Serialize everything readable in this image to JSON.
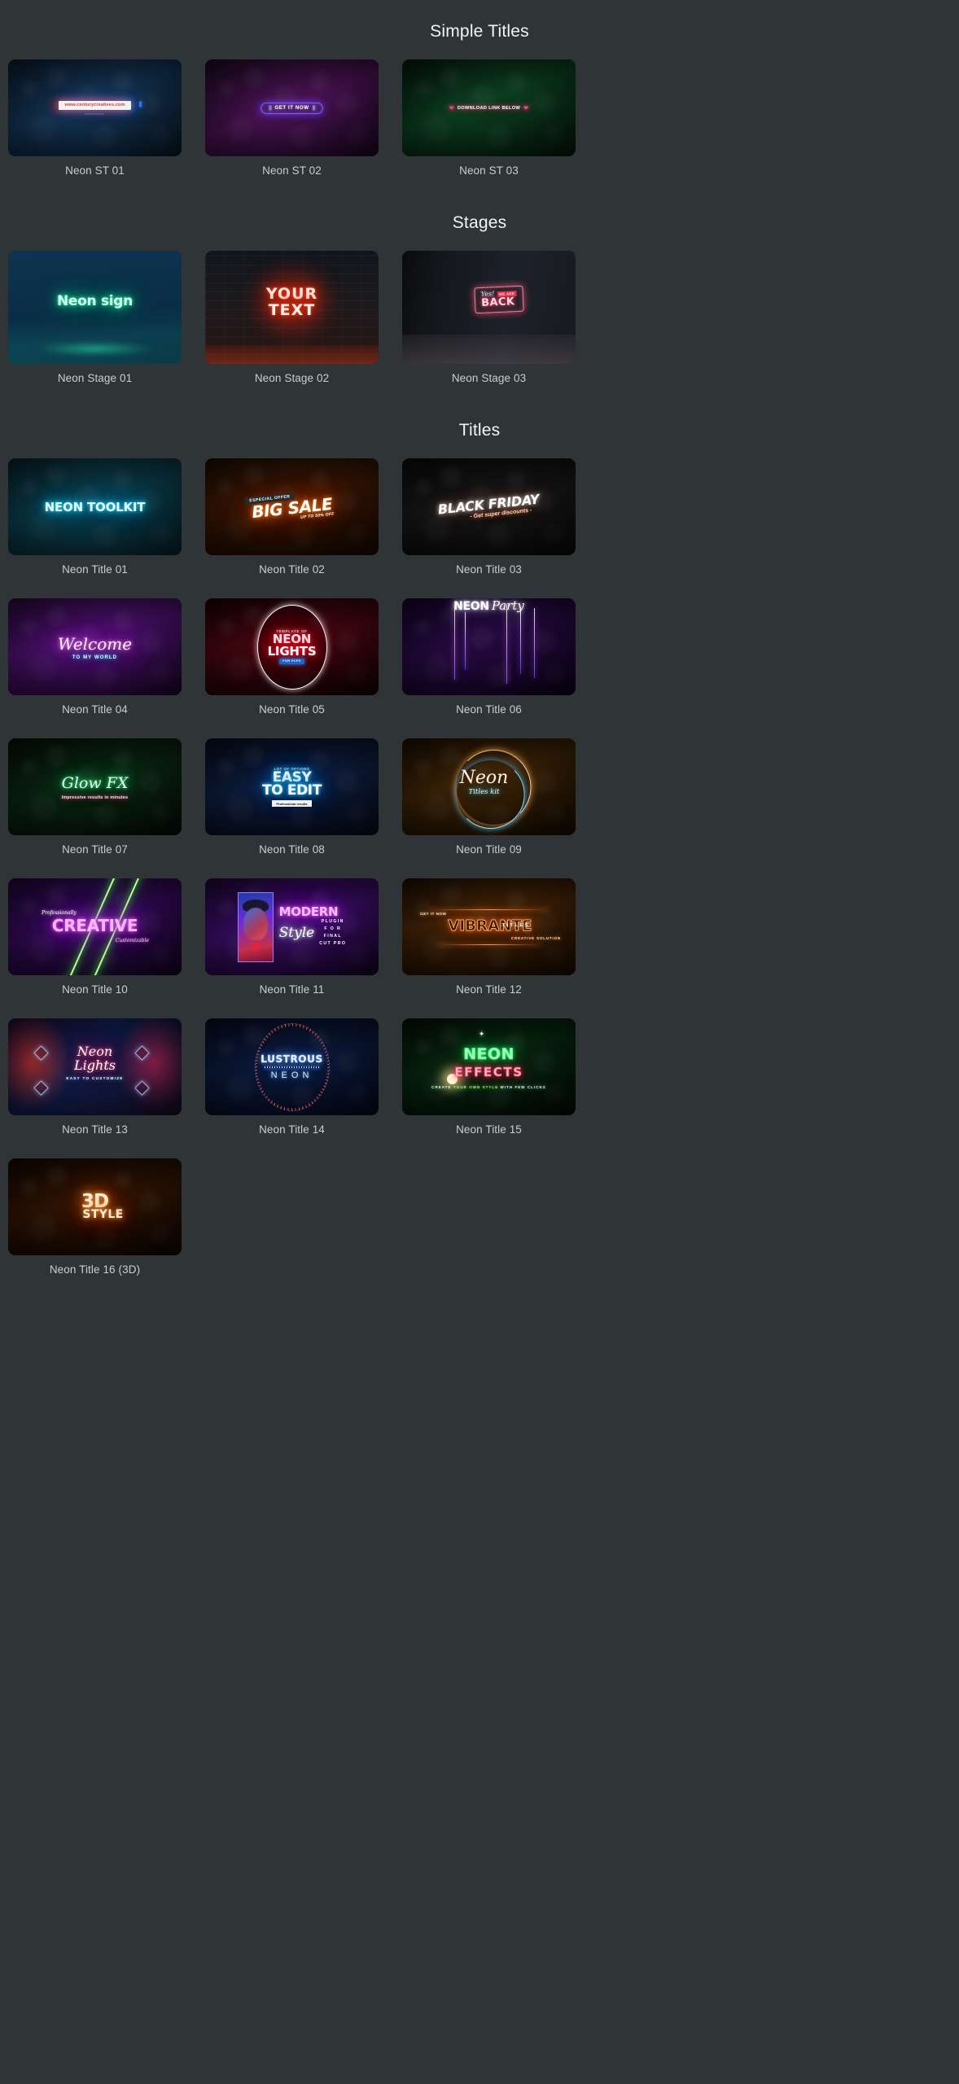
{
  "sections": [
    {
      "title": "Simple Titles",
      "items": [
        {
          "caption": "Neon ST 01",
          "art": {
            "url": "www.centurycreatives.com",
            "dots": "••••••••••••"
          }
        },
        {
          "caption": "Neon ST 02",
          "art": {
            "label": "GET IT NOW",
            "bars_left": "|||",
            "bars_right": "|||"
          }
        },
        {
          "caption": "Neon ST 03",
          "art": {
            "label": "DOWNLOAD LINK BELOW",
            "marker_left": "❤",
            "marker_right": "❤"
          }
        }
      ]
    },
    {
      "title": "Stages",
      "items": [
        {
          "caption": "Neon Stage 01",
          "art": {
            "line1": "Neon sign"
          }
        },
        {
          "caption": "Neon Stage 02",
          "art": {
            "line1": "YOUR",
            "line2": "TEXT"
          }
        },
        {
          "caption": "Neon Stage 03",
          "art": {
            "yes": "Yes!",
            "weare": "WE ARE",
            "back": "BACK"
          }
        }
      ]
    },
    {
      "title": "Titles",
      "items": [
        {
          "caption": "Neon Title 01",
          "art": {
            "line1": "NEON TOOLKIT"
          }
        },
        {
          "caption": "Neon Title 02",
          "art": {
            "eyebrow": "ESPECIAL OFFER",
            "line1": "BIG SALE",
            "sub": "UP TO 50% OFF"
          }
        },
        {
          "caption": "Neon Title 03",
          "art": {
            "line1": "BLACK FRIDAY",
            "sub": "- Get super discounts -"
          }
        },
        {
          "caption": "Neon Title 04",
          "art": {
            "line1": "Welcome",
            "sub": "TO MY WORLD"
          }
        },
        {
          "caption": "Neon Title 05",
          "art": {
            "eyebrow": "TEMPLATE OF",
            "line1": "NEON",
            "line2": "LIGHTS",
            "badge": "FOR FCPX"
          }
        },
        {
          "caption": "Neon Title 06",
          "art": {
            "line1": "NEON",
            "line2": "Party"
          }
        },
        {
          "caption": "Neon Title 07",
          "art": {
            "line1": "Glow FX",
            "sub": "Impressive results in minutes"
          }
        },
        {
          "caption": "Neon Title 08",
          "art": {
            "eyebrow": "LOT OF OPTIONS",
            "line1": "EASY",
            "line2": "TO EDIT",
            "badge": "Professional results"
          }
        },
        {
          "caption": "Neon Title 09",
          "art": {
            "line1": "Neon",
            "sub": "Titles kit"
          }
        },
        {
          "caption": "Neon Title 10",
          "art": {
            "eyebrow": "Professionally",
            "line1": "CREATIVE",
            "sub": "Customizable"
          }
        },
        {
          "caption": "Neon Title 11",
          "art": {
            "line1": "MODERN",
            "line2": "Style",
            "col": "PLUGIN\nF O R\nFINAL\nCUT PRO"
          }
        },
        {
          "caption": "Neon Title 12",
          "art": {
            "eyebrow": "GET IT NOW",
            "line1": "VIBRANTE",
            "tag": "TITLES",
            "sub": "CREATIVE SOLUTION"
          }
        },
        {
          "caption": "Neon Title 13",
          "art": {
            "line1": "Neon",
            "line2": "Lights",
            "sub": "EASY TO CUSTOMIZE"
          }
        },
        {
          "caption": "Neon Title 14",
          "art": {
            "line1": "LUSTROUS",
            "line2": "NEON"
          }
        },
        {
          "caption": "Neon Title 15",
          "art": {
            "line1": "NEON",
            "line2": "EFFECTS",
            "sub_a": "CREATE ",
            "sub_b": "YOUR OWN STYLE",
            "sub_c": " WITH FEW CLICKS"
          }
        },
        {
          "caption": "Neon Title 16 (3D)",
          "art": {
            "line1": "3D",
            "line2": "STYLE"
          }
        }
      ]
    }
  ],
  "colors": {
    "background": "#2f3436",
    "caption": "#c9ced1",
    "heading": "#f2f4f5"
  }
}
